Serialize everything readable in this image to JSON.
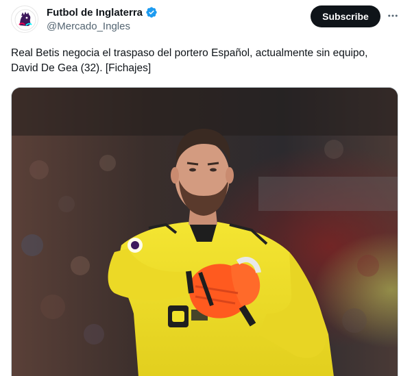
{
  "tweet": {
    "display_name": "Futbol de Inglaterra",
    "handle": "@Mercado_Ingles",
    "subscribe_label": "Subscribe",
    "text": "Real Betis negocia el traspaso del portero Español, actualmente sin equipo, David De Gea (32). [Fichajes]",
    "avatar_icon": "premier-league-lion-icon",
    "verified_icon": "verified-badge-icon",
    "more_icon": "more-dots-icon"
  },
  "colors": {
    "text_primary": "#0f1419",
    "text_secondary": "#536471",
    "verified": "#1d9bf0",
    "subscribe_bg": "#0f1419",
    "jersey": "#f2e22b",
    "gloves": "#ff5a1f"
  }
}
